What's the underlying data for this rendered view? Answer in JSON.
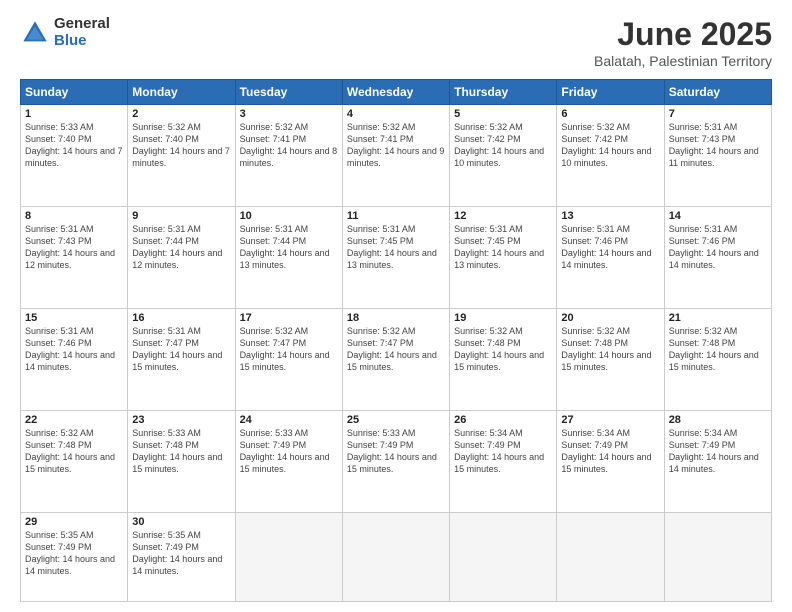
{
  "logo": {
    "general": "General",
    "blue": "Blue"
  },
  "header": {
    "month_year": "June 2025",
    "location": "Balatah, Palestinian Territory"
  },
  "weekdays": [
    "Sunday",
    "Monday",
    "Tuesday",
    "Wednesday",
    "Thursday",
    "Friday",
    "Saturday"
  ],
  "weeks": [
    [
      {
        "day": "1",
        "sunrise": "5:33 AM",
        "sunset": "7:40 PM",
        "daylight": "14 hours and 7 minutes."
      },
      {
        "day": "2",
        "sunrise": "5:32 AM",
        "sunset": "7:40 PM",
        "daylight": "14 hours and 7 minutes."
      },
      {
        "day": "3",
        "sunrise": "5:32 AM",
        "sunset": "7:41 PM",
        "daylight": "14 hours and 8 minutes."
      },
      {
        "day": "4",
        "sunrise": "5:32 AM",
        "sunset": "7:41 PM",
        "daylight": "14 hours and 9 minutes."
      },
      {
        "day": "5",
        "sunrise": "5:32 AM",
        "sunset": "7:42 PM",
        "daylight": "14 hours and 10 minutes."
      },
      {
        "day": "6",
        "sunrise": "5:32 AM",
        "sunset": "7:42 PM",
        "daylight": "14 hours and 10 minutes."
      },
      {
        "day": "7",
        "sunrise": "5:31 AM",
        "sunset": "7:43 PM",
        "daylight": "14 hours and 11 minutes."
      }
    ],
    [
      {
        "day": "8",
        "sunrise": "5:31 AM",
        "sunset": "7:43 PM",
        "daylight": "14 hours and 12 minutes."
      },
      {
        "day": "9",
        "sunrise": "5:31 AM",
        "sunset": "7:44 PM",
        "daylight": "14 hours and 12 minutes."
      },
      {
        "day": "10",
        "sunrise": "5:31 AM",
        "sunset": "7:44 PM",
        "daylight": "14 hours and 13 minutes."
      },
      {
        "day": "11",
        "sunrise": "5:31 AM",
        "sunset": "7:45 PM",
        "daylight": "14 hours and 13 minutes."
      },
      {
        "day": "12",
        "sunrise": "5:31 AM",
        "sunset": "7:45 PM",
        "daylight": "14 hours and 13 minutes."
      },
      {
        "day": "13",
        "sunrise": "5:31 AM",
        "sunset": "7:46 PM",
        "daylight": "14 hours and 14 minutes."
      },
      {
        "day": "14",
        "sunrise": "5:31 AM",
        "sunset": "7:46 PM",
        "daylight": "14 hours and 14 minutes."
      }
    ],
    [
      {
        "day": "15",
        "sunrise": "5:31 AM",
        "sunset": "7:46 PM",
        "daylight": "14 hours and 14 minutes."
      },
      {
        "day": "16",
        "sunrise": "5:31 AM",
        "sunset": "7:47 PM",
        "daylight": "14 hours and 15 minutes."
      },
      {
        "day": "17",
        "sunrise": "5:32 AM",
        "sunset": "7:47 PM",
        "daylight": "14 hours and 15 minutes."
      },
      {
        "day": "18",
        "sunrise": "5:32 AM",
        "sunset": "7:47 PM",
        "daylight": "14 hours and 15 minutes."
      },
      {
        "day": "19",
        "sunrise": "5:32 AM",
        "sunset": "7:48 PM",
        "daylight": "14 hours and 15 minutes."
      },
      {
        "day": "20",
        "sunrise": "5:32 AM",
        "sunset": "7:48 PM",
        "daylight": "14 hours and 15 minutes."
      },
      {
        "day": "21",
        "sunrise": "5:32 AM",
        "sunset": "7:48 PM",
        "daylight": "14 hours and 15 minutes."
      }
    ],
    [
      {
        "day": "22",
        "sunrise": "5:32 AM",
        "sunset": "7:48 PM",
        "daylight": "14 hours and 15 minutes."
      },
      {
        "day": "23",
        "sunrise": "5:33 AM",
        "sunset": "7:48 PM",
        "daylight": "14 hours and 15 minutes."
      },
      {
        "day": "24",
        "sunrise": "5:33 AM",
        "sunset": "7:49 PM",
        "daylight": "14 hours and 15 minutes."
      },
      {
        "day": "25",
        "sunrise": "5:33 AM",
        "sunset": "7:49 PM",
        "daylight": "14 hours and 15 minutes."
      },
      {
        "day": "26",
        "sunrise": "5:34 AM",
        "sunset": "7:49 PM",
        "daylight": "14 hours and 15 minutes."
      },
      {
        "day": "27",
        "sunrise": "5:34 AM",
        "sunset": "7:49 PM",
        "daylight": "14 hours and 15 minutes."
      },
      {
        "day": "28",
        "sunrise": "5:34 AM",
        "sunset": "7:49 PM",
        "daylight": "14 hours and 14 minutes."
      }
    ],
    [
      {
        "day": "29",
        "sunrise": "5:35 AM",
        "sunset": "7:49 PM",
        "daylight": "14 hours and 14 minutes."
      },
      {
        "day": "30",
        "sunrise": "5:35 AM",
        "sunset": "7:49 PM",
        "daylight": "14 hours and 14 minutes."
      },
      null,
      null,
      null,
      null,
      null
    ]
  ]
}
